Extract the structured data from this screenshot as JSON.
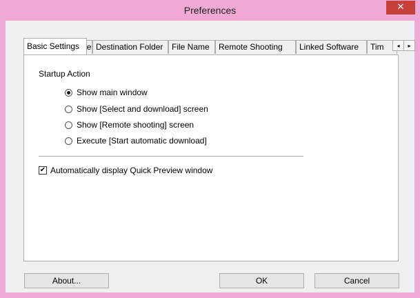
{
  "window": {
    "title": "Preferences",
    "close_glyph": "✕"
  },
  "tabs": [
    {
      "label": "Basic Settings"
    },
    {
      "label": "Destination Folder"
    },
    {
      "label": "File Name"
    },
    {
      "label": "Remote Shooting"
    },
    {
      "label": "Linked Software"
    },
    {
      "label": "Tim"
    }
  ],
  "tab_scroll": {
    "left_icon": "scroll-left-icon",
    "right_icon": "scroll-right-icon",
    "left_glyph": "◂",
    "right_glyph": "▸"
  },
  "startup": {
    "label": "Startup Action",
    "options": [
      {
        "label": "Show main window",
        "selected": true
      },
      {
        "label": "Show [Select and download] screen",
        "selected": false
      },
      {
        "label": "Show [Remote shooting] screen",
        "selected": false
      },
      {
        "label": "Execute [Start automatic download]",
        "selected": false
      }
    ]
  },
  "quick_preview": {
    "label": "Automatically display Quick Preview window",
    "checked": true,
    "check_glyph": "✔"
  },
  "buttons": {
    "about": "About...",
    "ok": "OK",
    "cancel": "Cancel"
  },
  "colors": {
    "title_bar": "#f0a8d4",
    "close_button": "#c7403a"
  }
}
